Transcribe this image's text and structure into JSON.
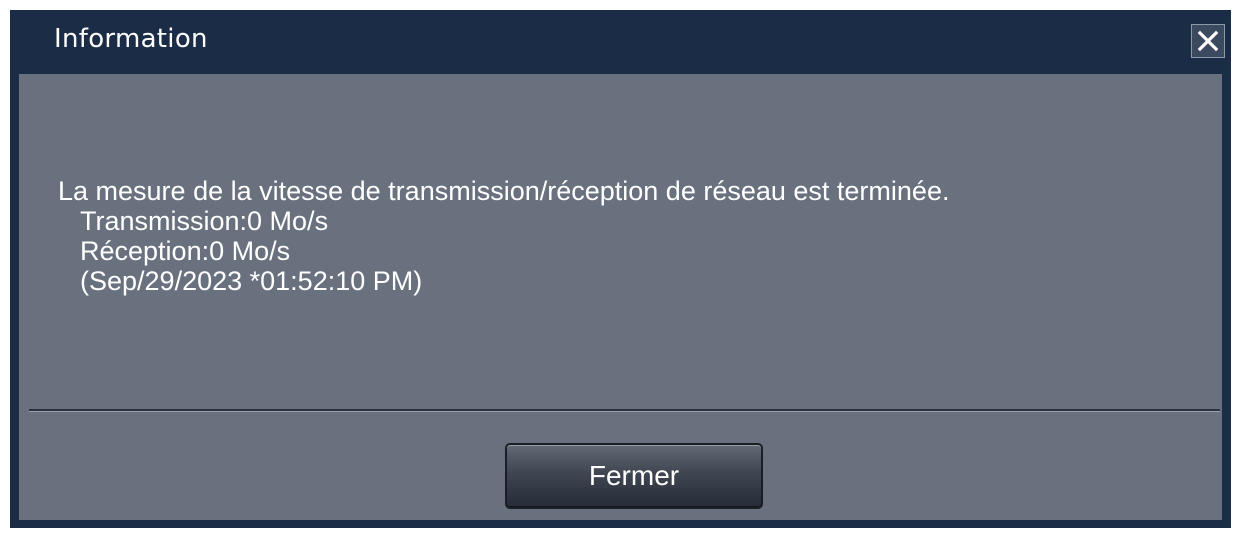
{
  "dialog": {
    "title": "Information",
    "close_icon": "close-icon"
  },
  "message": {
    "headline": "La mesure de la vitesse de transmission/réception de réseau est terminée.",
    "transmission": "Transmission:0 Mo/s",
    "reception": "Réception:0 Mo/s",
    "timestamp": "(Sep/29/2023 *01:52:10 PM)"
  },
  "buttons": {
    "close_label": "Fermer"
  },
  "colors": {
    "frame": "#1b2c46",
    "body": "#69717f",
    "text": "#ffffff"
  }
}
